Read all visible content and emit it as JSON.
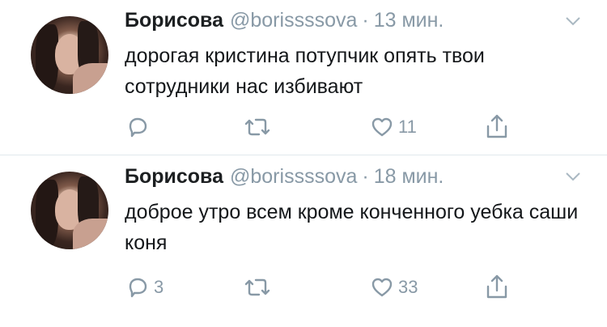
{
  "tweets": [
    {
      "name": "Борисова",
      "handle": "@borissssova",
      "dot": "·",
      "time": "13 мин.",
      "text": "дорогая кристина потупчик опять твои сотрудники нас избивают",
      "reply_count": "",
      "retweet_count": "",
      "like_count": "11"
    },
    {
      "name": "Борисова",
      "handle": "@borissssova",
      "dot": "·",
      "time": "18 мин.",
      "text": "доброе утро всем кроме конченного уебка саши коня",
      "reply_count": "3",
      "retweet_count": "",
      "like_count": "33"
    }
  ],
  "icons": {
    "reply": "reply-icon",
    "retweet": "retweet-icon",
    "like": "heart-icon",
    "share": "share-icon",
    "menu": "chevron-down-icon"
  },
  "colors": {
    "text": "#14171a",
    "secondary": "#8899a6",
    "divider": "#e1e8ed",
    "background": "#ffffff"
  }
}
